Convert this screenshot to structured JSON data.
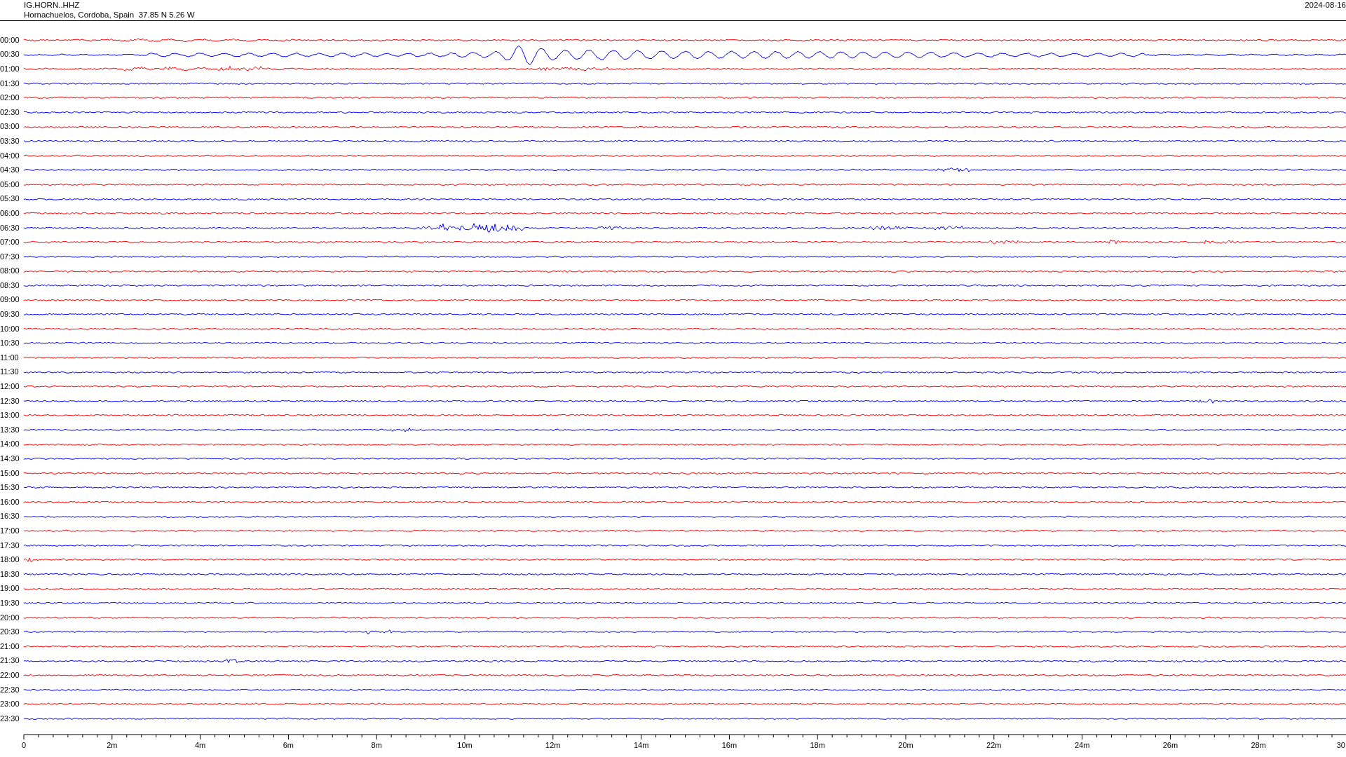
{
  "station": {
    "code": "IG.HORN..HHZ",
    "location": "Hornachuelos, Cordoba, Spain  37.85 N 5.26 W",
    "date": "2024-08-16"
  },
  "traces": [
    {
      "label": "00:00",
      "color": "#ff0000"
    },
    {
      "label": "00:30",
      "color": "#0000ff"
    },
    {
      "label": "01:00",
      "color": "#ff0000"
    },
    {
      "label": "01:30",
      "color": "#0000ff"
    },
    {
      "label": "02:00",
      "color": "#ff0000"
    },
    {
      "label": "02:30",
      "color": "#0000ff"
    },
    {
      "label": "03:00",
      "color": "#ff0000"
    },
    {
      "label": "03:30",
      "color": "#0000ff"
    },
    {
      "label": "04:00",
      "color": "#ff0000"
    },
    {
      "label": "04:30",
      "color": "#0000ff"
    },
    {
      "label": "05:00",
      "color": "#ff0000"
    },
    {
      "label": "05:30",
      "color": "#0000ff"
    },
    {
      "label": "06:00",
      "color": "#ff0000"
    },
    {
      "label": "06:30",
      "color": "#0000ff"
    },
    {
      "label": "07:00",
      "color": "#ff0000"
    },
    {
      "label": "07:30",
      "color": "#0000ff"
    },
    {
      "label": "08:00",
      "color": "#ff0000"
    },
    {
      "label": "08:30",
      "color": "#0000ff"
    },
    {
      "label": "09:00",
      "color": "#ff0000"
    },
    {
      "label": "09:30",
      "color": "#0000ff"
    },
    {
      "label": "10:00",
      "color": "#ff0000"
    },
    {
      "label": "10:30",
      "color": "#0000ff"
    },
    {
      "label": "11:00",
      "color": "#ff0000"
    },
    {
      "label": "11:30",
      "color": "#0000ff"
    },
    {
      "label": "12:00",
      "color": "#ff0000"
    },
    {
      "label": "12:30",
      "color": "#0000ff"
    },
    {
      "label": "13:00",
      "color": "#ff0000"
    },
    {
      "label": "13:30",
      "color": "#0000ff"
    },
    {
      "label": "14:00",
      "color": "#ff0000"
    },
    {
      "label": "14:30",
      "color": "#0000ff"
    },
    {
      "label": "15:00",
      "color": "#ff0000"
    },
    {
      "label": "15:30",
      "color": "#0000ff"
    },
    {
      "label": "16:00",
      "color": "#ff0000"
    },
    {
      "label": "16:30",
      "color": "#0000ff"
    },
    {
      "label": "17:00",
      "color": "#ff0000"
    },
    {
      "label": "17:30",
      "color": "#0000ff"
    },
    {
      "label": "18:00",
      "color": "#ff0000"
    },
    {
      "label": "18:30",
      "color": "#0000ff"
    },
    {
      "label": "19:00",
      "color": "#ff0000"
    },
    {
      "label": "19:30",
      "color": "#0000ff"
    },
    {
      "label": "20:00",
      "color": "#ff0000"
    },
    {
      "label": "20:30",
      "color": "#0000ff"
    },
    {
      "label": "21:00",
      "color": "#ff0000"
    },
    {
      "label": "21:30",
      "color": "#0000ff"
    },
    {
      "label": "22:00",
      "color": "#ff0000"
    },
    {
      "label": "22:30",
      "color": "#0000ff"
    },
    {
      "label": "23:00",
      "color": "#ff0000"
    },
    {
      "label": "23:30",
      "color": "#0000ff"
    }
  ],
  "time_axis": {
    "labels": [
      "0",
      "2m",
      "4m",
      "6m",
      "8m",
      "10m",
      "12m",
      "14m",
      "16m",
      "18m",
      "20m",
      "22m",
      "24m",
      "26m",
      "28m",
      "30"
    ]
  }
}
